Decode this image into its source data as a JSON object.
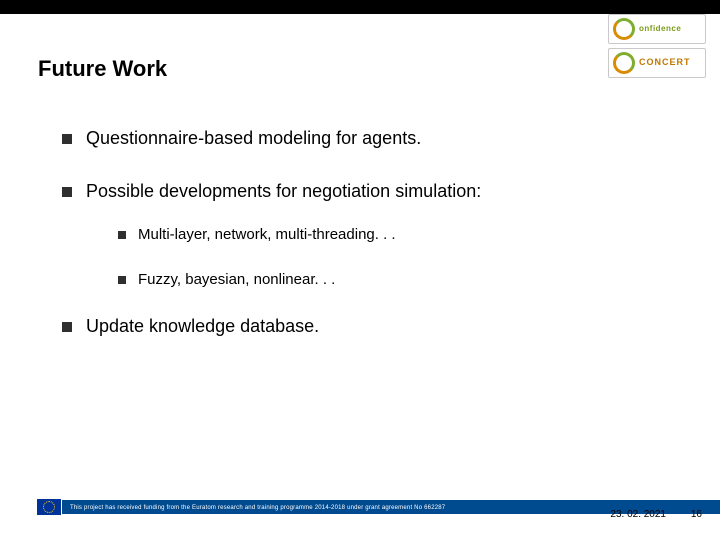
{
  "title": "Future Work",
  "bullets": {
    "b1": "Questionnaire-based modeling for agents.",
    "b2": "Possible developments for negotiation simulation:",
    "b2_sub": {
      "s1": "Multi-layer, network, multi-threading. . .",
      "s2": "Fuzzy, bayesian, nonlinear. . ."
    },
    "b3": "Update knowledge database."
  },
  "logos": {
    "confidence": {
      "brand": "onfidence",
      "tag": ""
    },
    "concert": {
      "brand": "CONCERT",
      "tag": ""
    }
  },
  "footer": {
    "funding": "This project has received funding from the Euratom research and training programme 2014-2018 under grant agreement No 662287",
    "date": "23. 02. 2021",
    "page": "16"
  }
}
